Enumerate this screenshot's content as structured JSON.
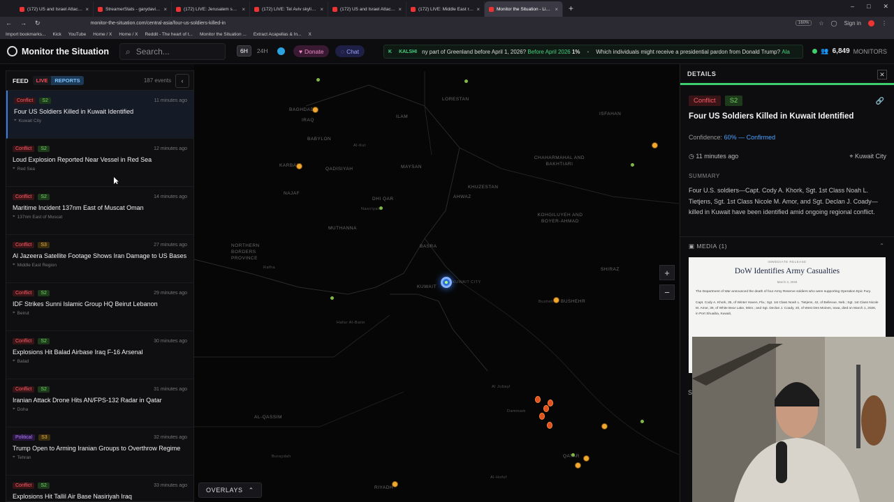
{
  "browser": {
    "tabs": [
      {
        "label": "(172) US and Israel Attack Iran",
        "active": false
      },
      {
        "label": "StreamerStats - garydavid Stre",
        "active": false
      },
      {
        "label": "(172) LIVE: Jerusalem skyline as",
        "active": false
      },
      {
        "label": "(172) LIVE: Tel Aviv skyline as Ir",
        "active": false
      },
      {
        "label": "(172) US and Israel Attack Iran",
        "active": false
      },
      {
        "label": "(172) LIVE: Middle East real",
        "active": false
      },
      {
        "label": "Monitor the Situation - Live Gl",
        "active": true
      }
    ],
    "url": "monitor-the-situation.com/central-asia/four-us-soldiers-killed-in",
    "zoom": "160%",
    "signin": "Sign in",
    "bookmarks": [
      "Import bookmarks...",
      "Kick",
      "YouTube",
      "Home / X",
      "Home / X",
      "Reddit - The heart of t...",
      "Monitor the Situation ...",
      "Extract Acapellas & In...",
      "X"
    ]
  },
  "header": {
    "app_title": "Monitor the Situation",
    "search_placeholder": "Search...",
    "range_6h": "6H",
    "range_24h": "24H",
    "donate": "Donate",
    "chat": "Chat",
    "ticker_brand": "KALSHI",
    "ticker_text_1": "ny part of Greenland before April 1, 2026?",
    "ticker_highlight": "Before April 2026",
    "ticker_pct": "1%",
    "ticker_text_2": "Which individuals might receive a presidential pardon from Donald Trump?",
    "ticker_tail": "Ala",
    "monitors_count": "6,849",
    "monitors_label": "MONITORS"
  },
  "feed": {
    "title": "FEED",
    "live": "LIVE",
    "reports": "REPORTS",
    "count": "187 events",
    "items": [
      {
        "category": "Conflict",
        "cat_class": "conflict",
        "severity": "S2",
        "sev_class": "s2",
        "time": "11 minutes ago",
        "title": "Four US Soldiers Killed in Kuwait Identified",
        "location": "Kuwait City",
        "selected": true
      },
      {
        "category": "Conflict",
        "cat_class": "conflict",
        "severity": "S2",
        "sev_class": "s2",
        "time": "12 minutes ago",
        "title": "Loud Explosion Reported Near Vessel in Red Sea",
        "location": "Red Sea",
        "selected": false
      },
      {
        "category": "Conflict",
        "cat_class": "conflict",
        "severity": "S2",
        "sev_class": "s2",
        "time": "14 minutes ago",
        "title": "Maritime Incident 137nm East of Muscat Oman",
        "location": "137nm East of Muscat",
        "selected": false
      },
      {
        "category": "Conflict",
        "cat_class": "conflict",
        "severity": "S3",
        "sev_class": "s3",
        "time": "27 minutes ago",
        "title": "Al Jazeera Satellite Footage Shows Iran Damage to US Bases",
        "location": "Middle East Region",
        "selected": false
      },
      {
        "category": "Conflict",
        "cat_class": "conflict",
        "severity": "S2",
        "sev_class": "s2",
        "time": "29 minutes ago",
        "title": "IDF Strikes Sunni Islamic Group HQ Beirut Lebanon",
        "location": "Beirut",
        "selected": false
      },
      {
        "category": "Conflict",
        "cat_class": "conflict",
        "severity": "S2",
        "sev_class": "s2",
        "time": "30 minutes ago",
        "title": "Explosions Hit Balad Airbase Iraq F-16 Arsenal",
        "location": "Balad",
        "selected": false
      },
      {
        "category": "Conflict",
        "cat_class": "conflict",
        "severity": "S2",
        "sev_class": "s2",
        "time": "31 minutes ago",
        "title": "Iranian Attack Drone Hits AN/FPS-132 Radar in Qatar",
        "location": "Doha",
        "selected": false
      },
      {
        "category": "Political",
        "cat_class": "political",
        "severity": "S3",
        "sev_class": "s3",
        "time": "32 minutes ago",
        "title": "Trump Open to Arming Iranian Groups to Overthrow Regime",
        "location": "Tehran",
        "selected": false
      },
      {
        "category": "Conflict",
        "cat_class": "conflict",
        "severity": "S2",
        "sev_class": "s2",
        "time": "33 minutes ago",
        "title": "Explosions Hit Tallil Air Base Nasiriyah Iraq",
        "location": "",
        "selected": false
      }
    ]
  },
  "map": {
    "labels": [
      "BAGHDAD",
      "IRAQ",
      "BABYLON",
      "KARBALA",
      "QADISIYAH",
      "NAJAF",
      "MAYSAN",
      "LORESTAN",
      "ILAM",
      "KHUZESTAN",
      "AHWAZ",
      "DHI QAR",
      "MUTHANNA",
      "BASRA",
      "KUWAIT",
      "NORTHERN BORDERS PROVINCE",
      "ISFAHAN",
      "CHAHARMAHAL AND BAKHTIARI",
      "KOHGILUYEH AND BOYER-AHMAD",
      "SHIRAZ",
      "BUSHEHR",
      "AL-QASSIM",
      "RIYADH",
      "QATAR"
    ],
    "city_labels": [
      "Hafar Al-Batin",
      "Rafha",
      "Nasiriyah",
      "Al-Kut",
      "Al Jubayl",
      "Dammam",
      "Al-Hofuf",
      "Buraydah",
      "KUWAIT CITY",
      "Bushehr"
    ],
    "overlays_label": "OVERLAYS",
    "zoom_in": "+",
    "zoom_out": "−"
  },
  "details": {
    "header": "DETAILS",
    "category": "Conflict",
    "severity": "S2",
    "title": "Four US Soldiers Killed in Kuwait Identified",
    "confidence_label": "Confidence:",
    "confidence_value": "60% — Confirmed",
    "time": "11 minutes ago",
    "location": "Kuwait City",
    "summary_label": "SUMMARY",
    "summary": "Four U.S. soldiers—Capt. Cody A. Khork, Sgt. 1st Class Noah L. Tietjens, Sgt. 1st Class Nicole M. Amor, and Sgt. Declan J. Coady—killed in Kuwait have been identified amid ongoing regional conflict.",
    "media_label": "MEDIA (1)",
    "media": {
      "kicker": "IMMEDIATE RELEASE",
      "headline": "DoW Identifies Army Casualties",
      "date": "March 3, 2026",
      "para1": "The Department of War announced the death of four Army Reserve soldiers who were supporting Operation Epic Fury.",
      "para2": "Capt. Cody A. Khork, 35, of Winter Haven, Fla.; Sgt. 1st Class Noah L. Tietjens, 42, of Bellevue, Neb.; Sgt. 1st Class Nicole M. Amor, 39, of White Bear Lake, Minn.; and Sgt. Declan J. Coady, 20, of West Des Moines, Iowa, died on March 1, 2026, in Port Shuaiba, Kuwait,"
    }
  },
  "colors": {
    "accent_green": "#3ecf6e",
    "conflict_red": "#ff5a66",
    "confidence_blue": "#4aa3ff",
    "pin_orange": "#f0a830"
  }
}
